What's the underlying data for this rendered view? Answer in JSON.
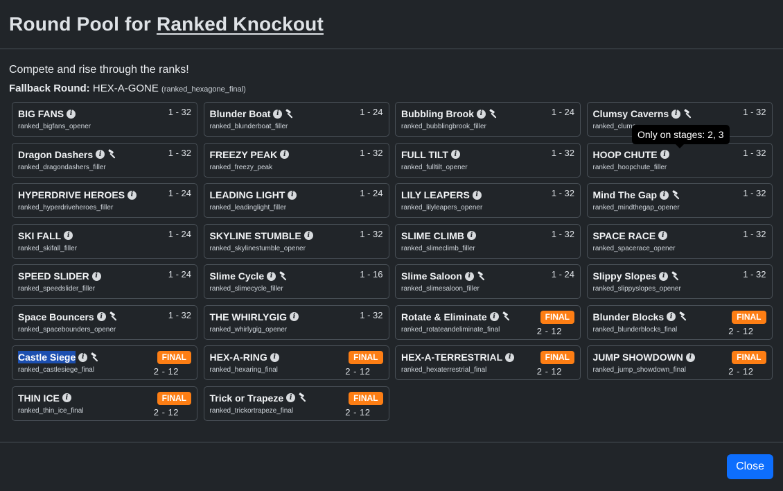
{
  "header": {
    "title_prefix": "Round Pool for ",
    "title_link": "Ranked Knockout"
  },
  "description": "Compete and rise through the ranks!",
  "fallback": {
    "label": "Fallback Round:",
    "name": "HEX-A-GONE",
    "code": "(ranked_hexagone_final)"
  },
  "tooltip": "Only on stages: 2, 3",
  "close_label": "Close",
  "final_label": "FINAL",
  "rounds": [
    {
      "name": "BIG FANS",
      "code": "ranked_bigfans_opener",
      "range": "1 - 32",
      "hammer": false,
      "final": false
    },
    {
      "name": "Blunder Boat",
      "code": "ranked_blunderboat_filler",
      "range": "1 - 24",
      "hammer": true,
      "final": false
    },
    {
      "name": "Bubbling Brook",
      "code": "ranked_bubblingbrook_filler",
      "range": "1 - 24",
      "hammer": true,
      "final": false
    },
    {
      "name": "Clumsy Caverns",
      "code": "ranked_clums",
      "range": "1 - 32",
      "hammer": true,
      "final": false
    },
    {
      "name": "Dragon Dashers",
      "code": "ranked_dragondashers_filler",
      "range": "1 - 32",
      "hammer": true,
      "final": false
    },
    {
      "name": "FREEZY PEAK",
      "code": "ranked_freezy_peak",
      "range": "1 - 32",
      "hammer": false,
      "final": false
    },
    {
      "name": "FULL TILT",
      "code": "ranked_fulltilt_opener",
      "range": "1 - 32",
      "hammer": false,
      "final": false
    },
    {
      "name": "HOOP CHUTE",
      "code": "ranked_hoopchute_filler",
      "range": "1 - 32",
      "hammer": false,
      "final": false
    },
    {
      "name": "HYPERDRIVE HEROES",
      "code": "ranked_hyperdriveheroes_filler",
      "range": "1 - 24",
      "hammer": false,
      "final": false
    },
    {
      "name": "LEADING LIGHT",
      "code": "ranked_leadinglight_filler",
      "range": "1 - 24",
      "hammer": false,
      "final": false
    },
    {
      "name": "LILY LEAPERS",
      "code": "ranked_lilyleapers_opener",
      "range": "1 - 32",
      "hammer": false,
      "final": false
    },
    {
      "name": "Mind The Gap",
      "code": "ranked_mindthegap_opener",
      "range": "1 - 32",
      "hammer": true,
      "final": false
    },
    {
      "name": "SKI FALL",
      "code": "ranked_skifall_filler",
      "range": "1 - 24",
      "hammer": false,
      "final": false
    },
    {
      "name": "SKYLINE STUMBLE",
      "code": "ranked_skylinestumble_opener",
      "range": "1 - 32",
      "hammer": false,
      "final": false
    },
    {
      "name": "SLIME CLIMB",
      "code": "ranked_slimeclimb_filler",
      "range": "1 - 32",
      "hammer": false,
      "final": false
    },
    {
      "name": "SPACE RACE",
      "code": "ranked_spacerace_opener",
      "range": "1 - 32",
      "hammer": false,
      "final": false
    },
    {
      "name": "SPEED SLIDER",
      "code": "ranked_speedslider_filler",
      "range": "1 - 24",
      "hammer": false,
      "final": false
    },
    {
      "name": "Slime Cycle",
      "code": "ranked_slimecycle_filler",
      "range": "1 - 16",
      "hammer": true,
      "final": false
    },
    {
      "name": "Slime Saloon",
      "code": "ranked_slimesaloon_filler",
      "range": "1 - 24",
      "hammer": true,
      "final": false
    },
    {
      "name": "Slippy Slopes",
      "code": "ranked_slippyslopes_opener",
      "range": "1 - 32",
      "hammer": true,
      "final": false
    },
    {
      "name": "Space Bouncers",
      "code": "ranked_spacebounders_opener",
      "range": "1 - 32",
      "hammer": true,
      "final": false
    },
    {
      "name": "THE WHIRLYGIG",
      "code": "ranked_whirlygig_opener",
      "range": "1 - 32",
      "hammer": false,
      "final": false
    },
    {
      "name": "Rotate & Eliminate",
      "code": "ranked_rotateandeliminate_final",
      "range": "2 - 12",
      "hammer": true,
      "final": true
    },
    {
      "name": "Blunder Blocks",
      "code": "ranked_blunderblocks_final",
      "range": "2 - 12",
      "hammer": true,
      "final": true
    },
    {
      "name": "Castle Siege",
      "code": "ranked_castlesiege_final",
      "range": "2 - 12",
      "hammer": true,
      "final": true,
      "highlight": true
    },
    {
      "name": "HEX-A-RING",
      "code": "ranked_hexaring_final",
      "range": "2 - 12",
      "hammer": false,
      "final": true
    },
    {
      "name": "HEX-A-TERRESTRIAL",
      "code": "ranked_hexaterrestrial_final",
      "range": "2 - 12",
      "hammer": false,
      "final": true
    },
    {
      "name": "JUMP SHOWDOWN",
      "code": "ranked_jump_showdown_final",
      "range": "2 - 12",
      "hammer": false,
      "final": true
    },
    {
      "name": "THIN ICE",
      "code": "ranked_thin_ice_final",
      "range": "2 - 12",
      "hammer": false,
      "final": true
    },
    {
      "name": "Trick or Trapeze",
      "code": "ranked_trickortrapeze_final",
      "range": "2 - 12",
      "hammer": true,
      "final": true
    }
  ]
}
